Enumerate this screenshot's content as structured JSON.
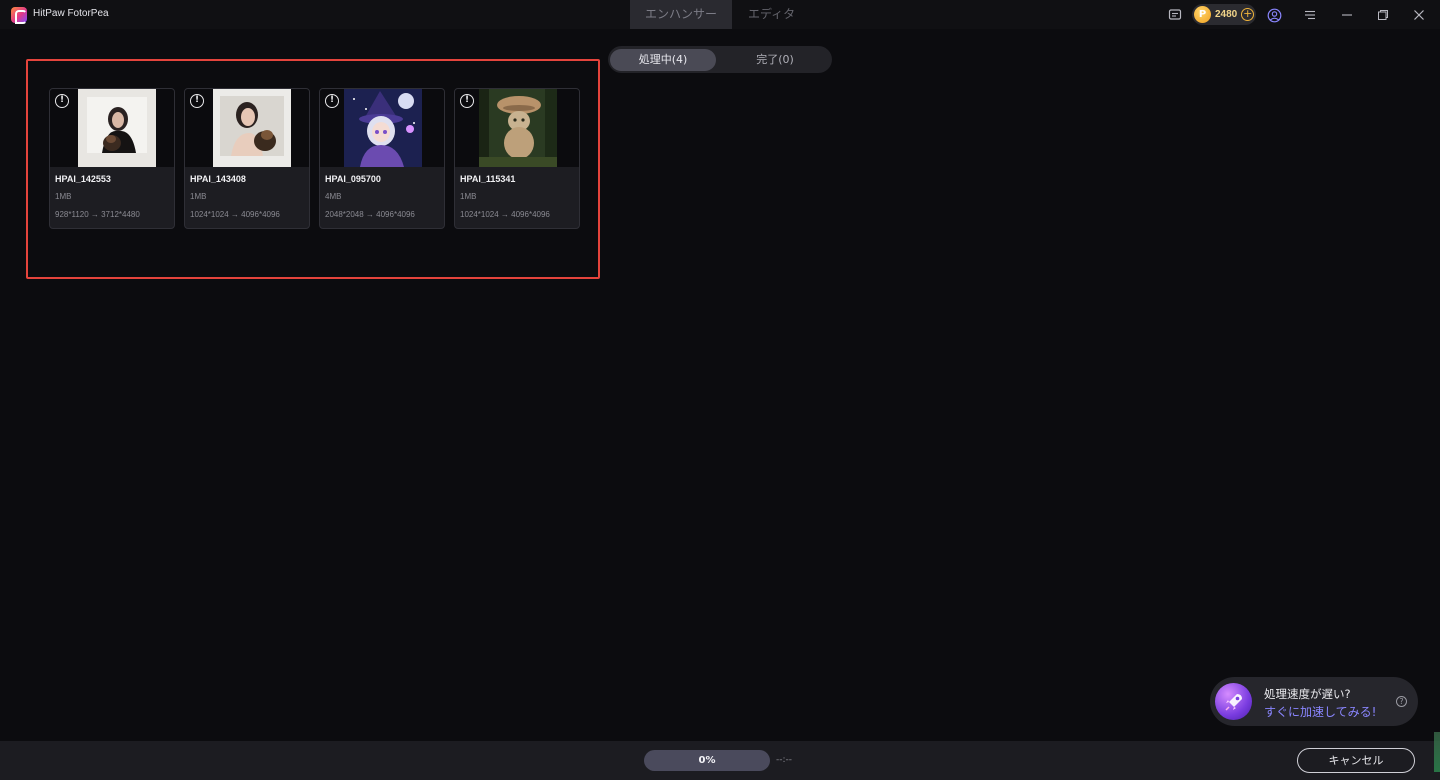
{
  "app": {
    "title": "HitPaw FotorPea"
  },
  "mode_tabs": [
    {
      "label": "エンハンサー",
      "active": true
    },
    {
      "label": "エディタ",
      "active": false
    }
  ],
  "titlebar": {
    "credits": "2480",
    "icons": [
      "feedback-icon",
      "coin-icon",
      "add-credits-icon",
      "account-icon",
      "menu-icon",
      "minimize-icon",
      "restore-icon",
      "close-icon"
    ]
  },
  "status_tabs": [
    {
      "label": "処理中(4)",
      "active": true
    },
    {
      "label": "完了(0)",
      "active": false
    }
  ],
  "cards": [
    {
      "name": "HPAI_142553",
      "size": "1MB",
      "resolution": "928*1120 → 3712*4480"
    },
    {
      "name": "HPAI_143408",
      "size": "1MB",
      "resolution": "1024*1024 → 4096*4096"
    },
    {
      "name": "HPAI_095700",
      "size": "4MB",
      "resolution": "2048*2048 → 4096*4096"
    },
    {
      "name": "HPAI_115341",
      "size": "1MB",
      "resolution": "1024*1024 → 4096*4096"
    }
  ],
  "promo": {
    "title": "処理速度が遅い?",
    "link": "すぐに加速してみる!",
    "help": "?"
  },
  "bottom": {
    "progress_text": "0%",
    "progress_value": 0,
    "time_left": "--:--",
    "cancel_label": "キャンセル"
  },
  "colors": {
    "accent_purple": "#6a5ad0",
    "highlight_red": "#e5443c",
    "credit_gold": "#f0b43a"
  }
}
